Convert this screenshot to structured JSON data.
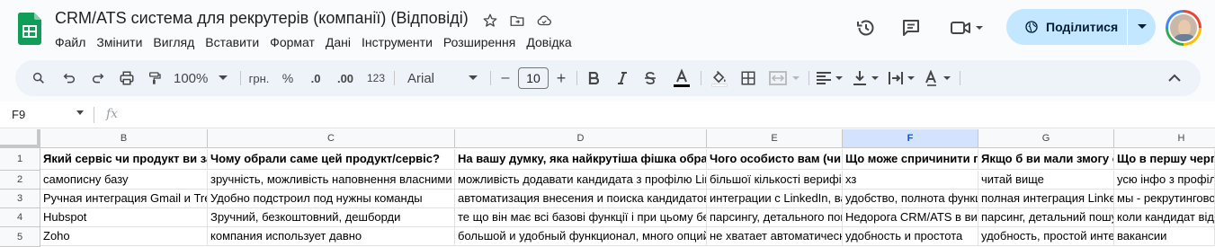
{
  "doc": {
    "title": "CRM/ATS система для рекрутерів (компанії) (Відповіді)",
    "menu": [
      "Файл",
      "Змінити",
      "Вигляд",
      "Вставити",
      "Формат",
      "Дані",
      "Інструменти",
      "Розширення",
      "Довідка"
    ],
    "share_label": "Поділитися"
  },
  "toolbar": {
    "zoom": "100%",
    "currency": "грн.",
    "percent": "%",
    "dec_decrease": ".0",
    "dec_increase": ".00",
    "number_format": "123",
    "font": "Arial",
    "font_size": "10",
    "minus": "–",
    "plus": "+"
  },
  "formula_bar": {
    "cell_ref": "F9",
    "fx": "fx"
  },
  "sheet": {
    "columns": [
      "B",
      "C",
      "D",
      "E",
      "F",
      "G",
      "H"
    ],
    "selected_column": "F",
    "rows": [
      "1",
      "2",
      "3",
      "4",
      "5"
    ],
    "cells": [
      [
        "Який сервіс чи продукт ви зараз використовуєте?",
        "Чому обрали саме цей продукт/сервіс?",
        "На вашу думку, яка найкрутіша фішка обраного сервісу?",
        "Чого особисто вам (чи вашій команді) не вистачає?",
        "Що може спричинити перехід на інший сервіс?",
        "Якщо б ви мали змогу обрати",
        "Що в першу чергу"
      ],
      [
        "самописну базу",
        "зручність, можливість наповнення власними полями",
        "можливість додавати кандидата з профілю LinkedIn",
        "більшої кількості верифікацій",
        "хз",
        "читай вище",
        "усю інфо з профілю"
      ],
      [
        "Ручная интеграция Gmail и Trello",
        "Удобно подстроил под нужны команды",
        "автоматизация внесения и поиска кандидатов",
        "интеграции с LinkedIn, вакансиями",
        "удобство, полнота функционала",
        "полная интеграция LinkedIn",
        "мы - рекрутинговое агентство"
      ],
      [
        "Hubspot",
        "Зручний, безкоштовний, дешборди",
        "те що він має всі базові функції і при цьому безкоштовний",
        "парсингу, детального пошуку",
        "Недорога CRM/ATS в використанні",
        "парсинг, детальний пошук",
        "коли кандидат відгукується"
      ],
      [
        "Zoho",
        "компания использует давно",
        "большой и удобный функционал, много опций",
        "не хватает автоматических рассылок",
        "удобность и простота",
        "удобность, простой интерфейс",
        "вакансии"
      ]
    ]
  },
  "colors": {
    "accent": "#0b57d0",
    "share_bg": "#c2e7ff",
    "sheets_green": "#0f9d58",
    "selected_header": "#d3e3fd"
  }
}
